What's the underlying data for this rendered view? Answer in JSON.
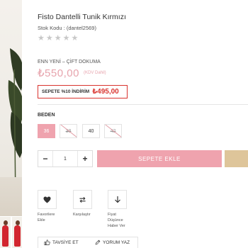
{
  "product": {
    "title": "Fisto Dantelli Tunik Kırmızı",
    "sku": "Stok Kodu : (dantel2569)",
    "rating_stars": "★★★★★",
    "rating": 0
  },
  "pricing": {
    "tag": "ENN YENİ – ÇİFT DOKUMA",
    "price": "₺550,00",
    "vat_note": "(KDV Dahil)",
    "discount_label": "SEPETE %10 İNDİRİM",
    "discount_price": "₺495,00"
  },
  "sizes": {
    "label": "BEDEN",
    "options": [
      {
        "label": "36",
        "state": "selected"
      },
      {
        "label": "38",
        "state": "unavailable"
      },
      {
        "label": "40",
        "state": "available"
      },
      {
        "label": "42",
        "state": "unavailable"
      }
    ]
  },
  "quantity": {
    "minus": "−",
    "value": "1",
    "plus": "+"
  },
  "cart": {
    "add_label": "SEPETE EKLE"
  },
  "actions": {
    "favorites": "Favorilere Ekle",
    "compare": "Karşılaştır",
    "price_alert": "Fiyat Düşünce Haber Ver"
  },
  "bottom": {
    "recommend": "TAVSİYE ET",
    "review": "YORUM YAZ"
  },
  "colors": {
    "accent_pink": "#efa3ae",
    "price_pink": "#e7a4ad",
    "discount_red": "#d9342f",
    "gold": "#dec59a"
  }
}
